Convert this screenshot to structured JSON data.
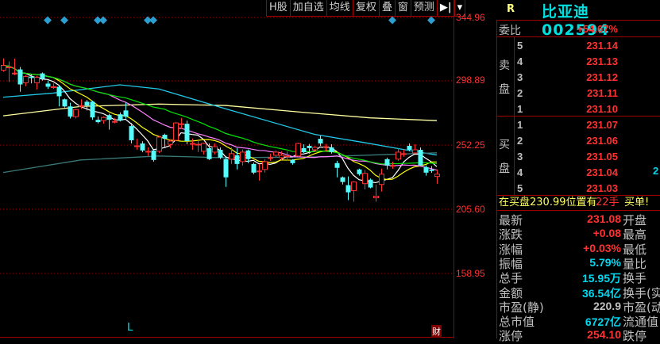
{
  "toolbar": {
    "buttons": [
      "H股",
      "加自选",
      "均线",
      "复权",
      "叠",
      "窗",
      "预测",
      "▶|",
      "▾"
    ]
  },
  "axis": {
    "labels": [
      "344.96",
      "298.89",
      "252.25",
      "205.60",
      "158.95"
    ],
    "values": [
      344.96,
      298.89,
      252.25,
      205.6,
      158.95
    ]
  },
  "markers": {
    "l_label": "L",
    "cai_label": "财"
  },
  "colors": {
    "up": "#ff3232",
    "down": "#54fcfc",
    "ma5": "#ffffff",
    "ma10": "#ffff00",
    "ma20": "#ff80ff",
    "ma30": "#00e600",
    "long1": "#ffffa0",
    "long2": "#20c8e8",
    "long3": "#3a7878",
    "diamond": "#2a9fd0",
    "grid": "#a00000"
  },
  "chart_data": {
    "type": "candlestick",
    "ylim": [
      158.95,
      344.96
    ],
    "yticks": [
      344.96,
      298.89,
      252.25,
      205.6,
      158.95
    ],
    "candles": [
      [
        306.6,
        315.2,
        305.5,
        310.1
      ],
      [
        309,
        313,
        298,
        309
      ],
      [
        304,
        315,
        303,
        304.5
      ],
      [
        307.2,
        309,
        291,
        296.3
      ],
      [
        297.5,
        303,
        295,
        302
      ],
      [
        302,
        304,
        297,
        300.9
      ],
      [
        297.5,
        302.5,
        292.7,
        301.5
      ],
      [
        304.3,
        305,
        299,
        300.3
      ],
      [
        296.9,
        299,
        293,
        294.6
      ],
      [
        294.6,
        297,
        293,
        294.6
      ],
      [
        294.6,
        295,
        280.3,
        287.7
      ],
      [
        285.5,
        286,
        279.5,
        280.3
      ],
      [
        280.3,
        283,
        271.5,
        272.9
      ],
      [
        272.9,
        278.5,
        271.5,
        278
      ],
      [
        280.9,
        285.5,
        278.5,
        280.9
      ],
      [
        283.7,
        285,
        277.4,
        280.9
      ],
      [
        283.7,
        284.5,
        270.6,
        272.3
      ],
      [
        270.6,
        273,
        268,
        268.9
      ],
      [
        270,
        273,
        267.7,
        272.3
      ],
      [
        274,
        275,
        263.5,
        270.6
      ],
      [
        269.4,
        272,
        268,
        269.4
      ],
      [
        274.6,
        276,
        269.4,
        270
      ],
      [
        277.4,
        283,
        271.5,
        272.9
      ],
      [
        266,
        268.3,
        253.4,
        255.7
      ],
      [
        251.1,
        256.8,
        248.8,
        251.7
      ],
      [
        253.4,
        255,
        247,
        248.3
      ],
      [
        247.1,
        250.5,
        244.3,
        247.7
      ],
      [
        248.3,
        249,
        240.2,
        241.4
      ],
      [
        247.7,
        259,
        246.5,
        258
      ],
      [
        259.7,
        260.5,
        250,
        256.8
      ],
      [
        252.8,
        256.5,
        250,
        255.1
      ],
      [
        255.7,
        269,
        255,
        268.3
      ],
      [
        267.7,
        272,
        264,
        267.7
      ],
      [
        267.7,
        270,
        252.8,
        255.1
      ],
      [
        253.4,
        257,
        248.8,
        253.4
      ],
      [
        252.8,
        256.5,
        247.1,
        252.8
      ],
      [
        247.7,
        254,
        245.4,
        253.4
      ],
      [
        250,
        253.4,
        241.4,
        242
      ],
      [
        247.1,
        253.4,
        245.4,
        251.1
      ],
      [
        248.8,
        250.5,
        242,
        243.1
      ],
      [
        242,
        243.1,
        221.9,
        228.8
      ],
      [
        242,
        250.5,
        238.5,
        246
      ],
      [
        244.8,
        250,
        234.5,
        238.5
      ],
      [
        240.2,
        249,
        237.4,
        247.1
      ],
      [
        248.3,
        249,
        239.1,
        242
      ],
      [
        238.5,
        239.5,
        231,
        232.2
      ],
      [
        232.8,
        238.5,
        226.5,
        233.4
      ],
      [
        234.5,
        242,
        232.2,
        240.2
      ],
      [
        243.1,
        246,
        240.8,
        243.1
      ],
      [
        244.8,
        248.3,
        243,
        247.1
      ],
      [
        243.1,
        247.7,
        241.4,
        244.8
      ],
      [
        244.3,
        247.7,
        240.8,
        244.3
      ],
      [
        241.4,
        242,
        238,
        239.1
      ],
      [
        244.3,
        254,
        243.7,
        253.4
      ],
      [
        250,
        252.8,
        246.5,
        247.1
      ],
      [
        251.7,
        253,
        246,
        250
      ],
      [
        248.8,
        251.5,
        247.7,
        250.5
      ],
      [
        256.8,
        259,
        251.7,
        253.4
      ],
      [
        251.1,
        253,
        247.7,
        251.1
      ],
      [
        250.5,
        252.8,
        246,
        247.1
      ],
      [
        239.1,
        240.8,
        228.8,
        235.7
      ],
      [
        228.8,
        229.4,
        223.6,
        225.4
      ],
      [
        223.1,
        229.4,
        212.2,
        217.9
      ],
      [
        219.1,
        226,
        211.1,
        225.4
      ],
      [
        234.5,
        235.1,
        230,
        231.1
      ],
      [
        224.2,
        234,
        220,
        231.6
      ],
      [
        227.1,
        228,
        220.8,
        221.4
      ],
      [
        213.9,
        223.6,
        211.1,
        215.1
      ],
      [
        223.6,
        235.1,
        218.5,
        231.1
      ],
      [
        242,
        243.1,
        234.5,
        237.4
      ],
      [
        237.4,
        240.2,
        235,
        237.4
      ],
      [
        242,
        250,
        240.8,
        247.1
      ],
      [
        246,
        249,
        243.7,
        246
      ],
      [
        251.7,
        253.4,
        247.7,
        248.8
      ],
      [
        246.5,
        252.8,
        246,
        248.8
      ],
      [
        248.8,
        250.5,
        236.8,
        237.4
      ],
      [
        236.2,
        237.4,
        230,
        232.2
      ],
      [
        234.5,
        237,
        232,
        233.4
      ],
      [
        229.4,
        234.5,
        224.2,
        231.08
      ]
    ],
    "ma_periods": [
      5,
      10,
      20,
      30
    ],
    "long_lines": [
      {
        "key": "long1",
        "points": [
          [
            0,
            273.5
          ],
          [
            14,
            280.3
          ],
          [
            28,
            282
          ],
          [
            40,
            281
          ],
          [
            54,
            276
          ],
          [
            66,
            272
          ],
          [
            78,
            270
          ]
        ]
      },
      {
        "key": "long2",
        "points": [
          [
            0,
            287
          ],
          [
            9,
            290
          ],
          [
            21,
            296
          ],
          [
            28,
            293
          ],
          [
            40,
            278.6
          ],
          [
            56,
            260
          ],
          [
            65,
            254
          ],
          [
            72,
            249
          ],
          [
            78,
            245
          ]
        ]
      },
      {
        "key": "long3",
        "points": [
          [
            0,
            232.3
          ],
          [
            14,
            241.4
          ],
          [
            28,
            244.3
          ],
          [
            40,
            243
          ],
          [
            57,
            243.7
          ],
          [
            70,
            245.5
          ],
          [
            78,
            246.6
          ]
        ]
      }
    ],
    "diamond_indices": [
      8,
      11,
      17,
      18,
      26,
      27,
      70,
      77
    ]
  },
  "panel": {
    "r_label": "R",
    "title": "比亚迪 002594",
    "weibi_label": "委比",
    "weibi_value": "+54.67%",
    "sell_label_1": "卖",
    "sell_label_2": "盘",
    "buy_label_1": "买",
    "buy_label_2": "盘",
    "sell": [
      {
        "level": "5",
        "price": "231.14"
      },
      {
        "level": "4",
        "price": "231.13"
      },
      {
        "level": "3",
        "price": "231.12"
      },
      {
        "level": "2",
        "price": "231.11"
      },
      {
        "level": "1",
        "price": "231.10"
      }
    ],
    "buy": [
      {
        "level": "1",
        "price": "231.07"
      },
      {
        "level": "2",
        "price": "231.06"
      },
      {
        "level": "3",
        "price": "231.05"
      },
      {
        "level": "4",
        "price": "231.04",
        "vol": "2"
      },
      {
        "level": "5",
        "price": "231.03"
      }
    ],
    "notice": {
      "text": "在买盘230.99位置有",
      "qty": "22手",
      "tag": "买单!"
    },
    "stats": [
      {
        "label": "最新",
        "value": "231.08",
        "color": "red",
        "label2": "开盘"
      },
      {
        "label": "涨跌",
        "value": "+0.08",
        "color": "red",
        "label2": "最高"
      },
      {
        "label": "涨幅",
        "value": "+0.03%",
        "color": "red",
        "label2": "最低"
      },
      {
        "label": "振幅",
        "value": "5.79%",
        "color": "cyan",
        "label2": "量比"
      },
      {
        "label": "总手",
        "value": "15.95万",
        "color": "cyan",
        "label2": "换手"
      },
      {
        "label": "金额",
        "value": "36.54亿",
        "color": "cyan",
        "label2": "换手(实)"
      },
      {
        "label": "市盈(静)",
        "value": "220.9",
        "color": "gray",
        "label2": "市盈(动)"
      },
      {
        "label": "总市值",
        "value": "6727亿",
        "color": "cyan",
        "label2": "流通值"
      },
      {
        "label": "涨停",
        "value": "254.10",
        "color": "red",
        "label2": "跌停"
      }
    ]
  }
}
